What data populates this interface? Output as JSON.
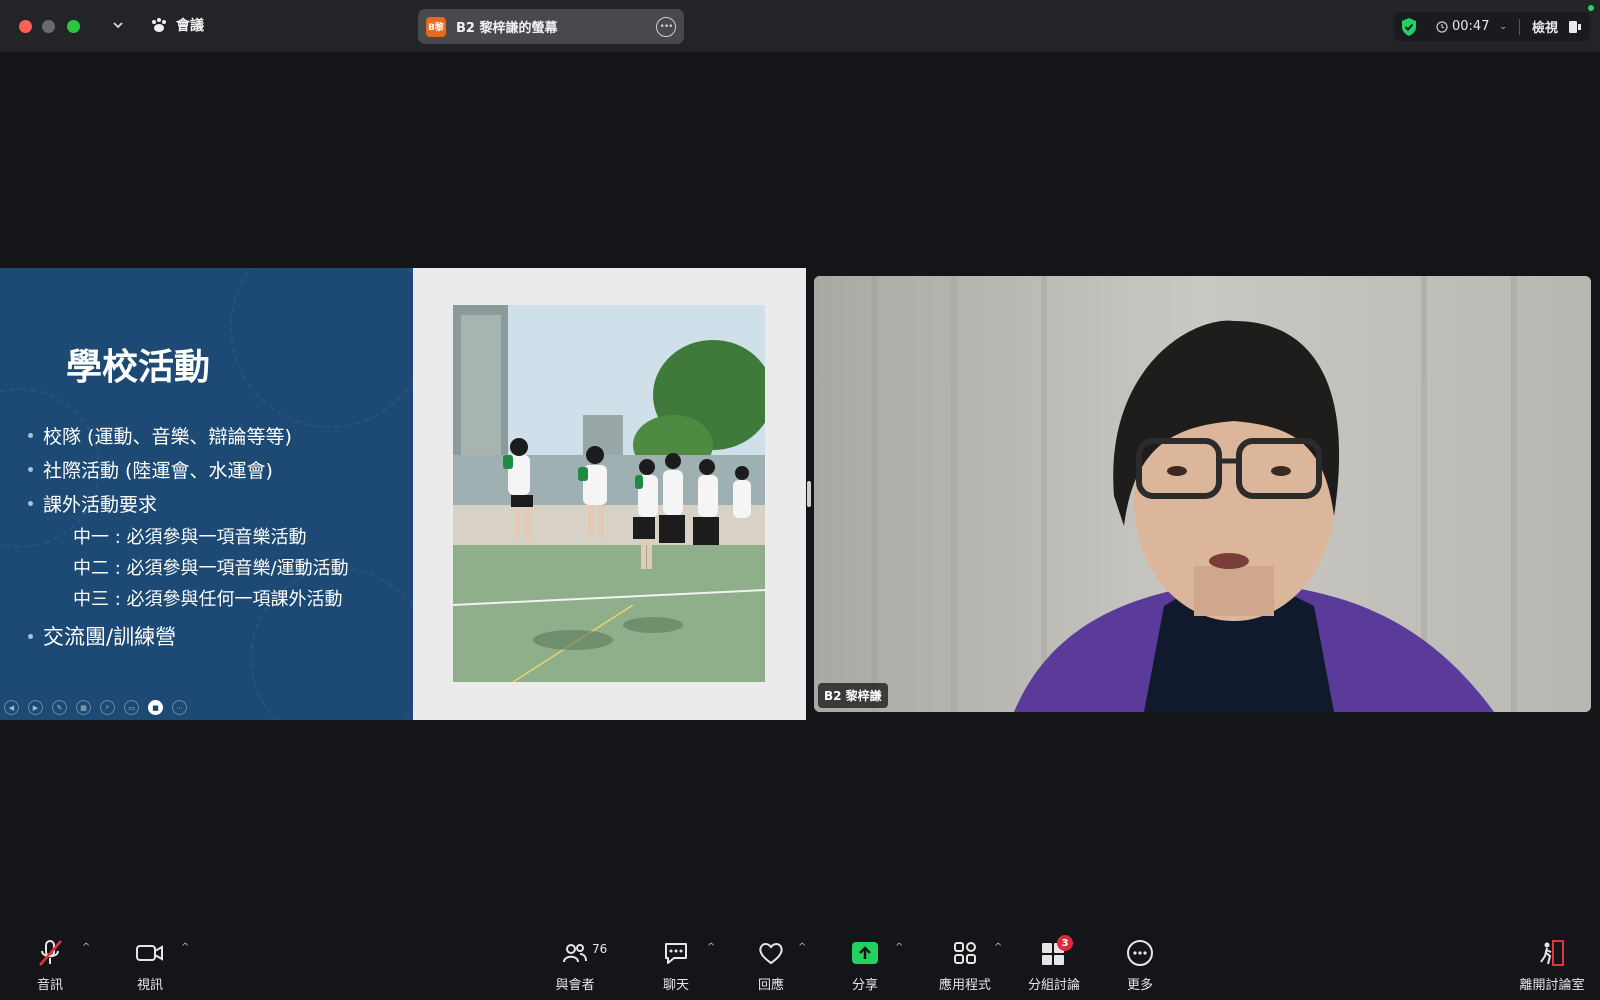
{
  "titlebar": {
    "meeting_label": "會議",
    "share_avatar": "B黎",
    "share_title": "B2 黎梓謙的螢幕",
    "timer": "00:47",
    "view_label": "檢視"
  },
  "slide": {
    "title": "學校活動",
    "bullets": [
      "校隊 (運動、音樂、辯論等等)",
      "社際活動 (陸運會、水運會)",
      "課外活動要求"
    ],
    "sub_bullets": [
      "中一 : 必須參與一項音樂活動",
      "中二 : 必須參與一項音樂/運動活動",
      "中三 : 必須參與任何一項課外活動"
    ],
    "last_bullet": "交流團/訓練營"
  },
  "video": {
    "participant_name": "B2 黎梓謙"
  },
  "toolbar": {
    "audio": "音訊",
    "video": "視訊",
    "participants": "與會者",
    "participants_count": "76",
    "chat": "聊天",
    "reactions": "回應",
    "share": "分享",
    "apps": "應用程式",
    "breakout": "分組討論",
    "breakout_badge": "3",
    "more": "更多",
    "leave": "離開討論室"
  },
  "colors": {
    "accent_green": "#23d160",
    "slide_blue": "#1c4a74",
    "badge_red": "#e02a3b"
  }
}
